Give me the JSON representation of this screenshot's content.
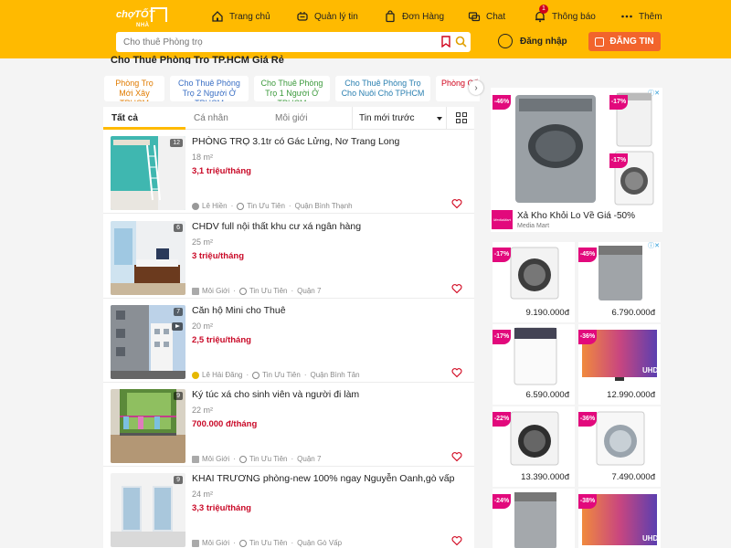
{
  "header": {
    "logo_main": "chợTỐT",
    "logo_sub": "NHÀ",
    "nav": [
      {
        "label": "Trang chủ",
        "icon": "home-icon"
      },
      {
        "label": "Quản lý tin",
        "icon": "manage-icon"
      },
      {
        "label": "Đơn Hàng",
        "icon": "order-bag-icon"
      },
      {
        "label": "Chat",
        "icon": "chat-icon"
      },
      {
        "label": "Thông báo",
        "icon": "bell-icon",
        "badge": "1"
      },
      {
        "label": "Thêm",
        "icon": "more-dots-icon"
      }
    ],
    "search_placeholder": "Cho thuê Phòng trọ",
    "login_label": "Đăng nhập",
    "post_label": "ĐĂNG TIN",
    "brand_color": "#ffba00",
    "post_color": "#f2642c"
  },
  "page_title": "Cho Thuê Phòng Trọ TP.HCM Giá Rẻ",
  "chips": [
    "Phòng Trọ Mới Xây TPHCM",
    "Cho Thuê Phòng Trọ 2 Người Ở TPHCM",
    "Cho Thuê Phòng Trọ 1 Người Ở TPHCM",
    "Cho Thuê Phòng Trọ Cho Nuôi Chó TPHCM",
    "Phòng Cấp"
  ],
  "tabs": {
    "all": "Tất cả",
    "personal": "Cá nhân",
    "broker": "Môi giới",
    "sort": "Tin mới trước"
  },
  "listings": [
    {
      "title": "PHÒNG TRỌ 3.1tr có Gác Lửng, Nơ Trang Long",
      "area": "18 m²",
      "price": "3,1 triệu/tháng",
      "seller": "Lê Hiền",
      "priority": "Tin Ưu Tiên",
      "district": "Quận Bình Thạnh",
      "photos": "12",
      "video": false
    },
    {
      "title": "CHDV full nội thất khu cư xá ngân hàng",
      "area": "25 m²",
      "price": "3 triệu/tháng",
      "seller": "Môi Giới",
      "priority": "Tin Ưu Tiên",
      "district": "Quận 7",
      "photos": "6",
      "video": false
    },
    {
      "title": "Căn hộ Mini cho Thuê",
      "area": "20 m²",
      "price": "2,5 triệu/tháng",
      "seller": "Lê Hải Đăng",
      "priority": "Tin Ưu Tiên",
      "district": "Quận Bình Tân",
      "photos": "7",
      "video": true
    },
    {
      "title": "Ký túc xá cho sinh viên và người đi làm",
      "area": "22 m²",
      "price": "700.000 đ/tháng",
      "seller": "Môi Giới",
      "priority": "Tin Ưu Tiên",
      "district": "Quận 7",
      "photos": "9",
      "video": false
    },
    {
      "title": "KHAI TRƯƠNG phòng-new 100% ngay Nguyễn Oanh,gò vấp",
      "area": "24 m²",
      "price": "3,3 triệu/tháng",
      "seller": "Môi Giới",
      "priority": "Tin Ưu Tiên",
      "district": "Quận Gò Vấp",
      "photos": "9",
      "video": false
    }
  ],
  "ads": {
    "top": {
      "disc1": "-46%",
      "disc2": "-17%",
      "disc3": "-17%",
      "headline": "Xả Kho Khỏi Lo Về Giá -50%",
      "brand": "Media Mart",
      "logo_text": "MediaMart"
    },
    "grid": [
      {
        "disc": "-17%",
        "price": "9.190.000đ"
      },
      {
        "disc": "-45%",
        "price": "6.790.000đ"
      },
      {
        "disc": "-17%",
        "price": "6.590.000đ"
      },
      {
        "disc": "-36%",
        "price": "12.990.000đ",
        "tv_label": "UHD"
      },
      {
        "disc": "-22%",
        "price": "13.390.000đ"
      },
      {
        "disc": "-36%",
        "price": "7.490.000đ"
      },
      {
        "disc": "-24%",
        "price": ""
      },
      {
        "disc": "-38%",
        "price": "",
        "tv_label": "UHD"
      }
    ],
    "accent": "#e2097c"
  }
}
